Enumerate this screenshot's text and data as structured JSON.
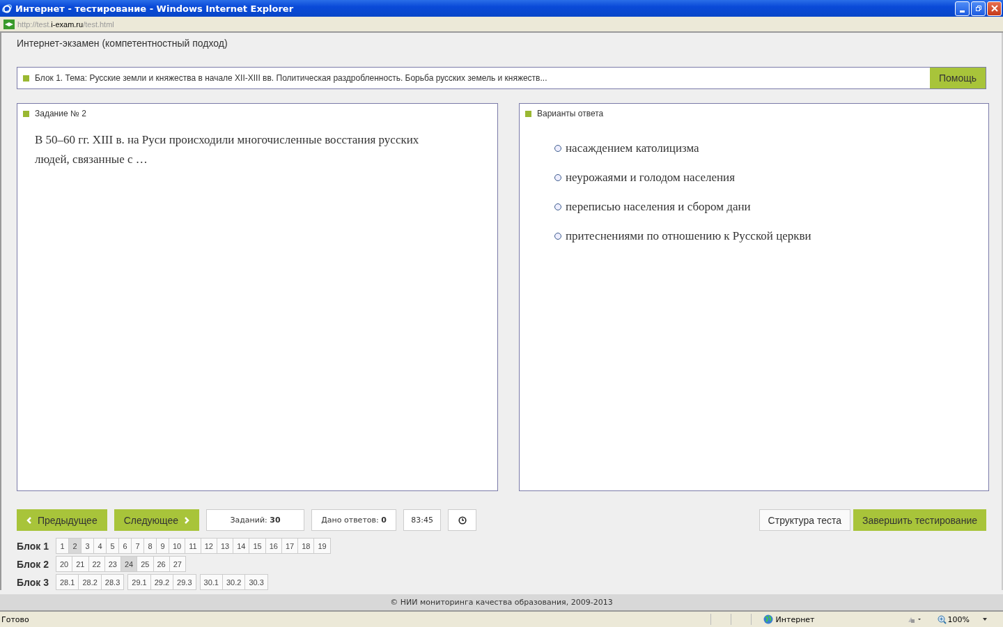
{
  "window": {
    "title": "Интернет - тестирование - Windows Internet Explorer"
  },
  "address": {
    "prefix": "http://test.",
    "domain": "i-exam.ru",
    "path": "/test.html"
  },
  "page_title": "Интернет-экзамен (компетентностный подход)",
  "topic": {
    "text": "Блок 1. Тема: Русские земли и княжества в начале XII-XIII вв. Политическая раздробленность. Борьба русских земель и княжеств...",
    "help_button": "Помощь"
  },
  "task": {
    "heading": "Задание № 2",
    "question": "В 50–60 гг. XIII в. на Руси происходили многочисленные восстания русских людей, связанные с …"
  },
  "answers": {
    "heading": "Варианты ответа",
    "options": [
      {
        "label": "насаждением католицизма",
        "selected": false
      },
      {
        "label": "неурожаями и голодом населения",
        "selected": false
      },
      {
        "label": "переписью населения и сбором дани",
        "selected": false
      },
      {
        "label": "притеснениями по отношению к Русской церкви",
        "selected": false
      }
    ]
  },
  "nav": {
    "prev": "Предыдущее",
    "next": "Следующее",
    "tasks_label": "Заданий:",
    "tasks_count": "30",
    "answered_label": "Дано ответов:",
    "answered_count": "0",
    "timer": "83:45",
    "structure": "Структура теста",
    "finish": "Завершить тестирование"
  },
  "blocks": [
    {
      "label": "Блок 1",
      "groups": [
        [
          {
            "n": "1",
            "selected": false
          },
          {
            "n": "2",
            "selected": true
          },
          {
            "n": "3",
            "selected": false
          },
          {
            "n": "4",
            "selected": false
          },
          {
            "n": "5",
            "selected": false
          },
          {
            "n": "6",
            "selected": false
          },
          {
            "n": "7",
            "selected": false
          },
          {
            "n": "8",
            "selected": false
          },
          {
            "n": "9",
            "selected": false
          },
          {
            "n": "10",
            "selected": false
          },
          {
            "n": "11",
            "selected": false
          },
          {
            "n": "12",
            "selected": false
          },
          {
            "n": "13",
            "selected": false
          },
          {
            "n": "14",
            "selected": false
          },
          {
            "n": "15",
            "selected": false
          },
          {
            "n": "16",
            "selected": false
          },
          {
            "n": "17",
            "selected": false
          },
          {
            "n": "18",
            "selected": false
          },
          {
            "n": "19",
            "selected": false
          }
        ]
      ]
    },
    {
      "label": "Блок 2",
      "groups": [
        [
          {
            "n": "20",
            "selected": false
          },
          {
            "n": "21",
            "selected": false
          },
          {
            "n": "22",
            "selected": false
          },
          {
            "n": "23",
            "selected": false
          },
          {
            "n": "24",
            "selected": true
          },
          {
            "n": "25",
            "selected": false
          },
          {
            "n": "26",
            "selected": false
          },
          {
            "n": "27",
            "selected": false
          }
        ]
      ]
    },
    {
      "label": "Блок 3",
      "groups": [
        [
          {
            "n": "28.1",
            "selected": false
          },
          {
            "n": "28.2",
            "selected": false
          },
          {
            "n": "28.3",
            "selected": false
          }
        ],
        [
          {
            "n": "29.1",
            "selected": false
          },
          {
            "n": "29.2",
            "selected": false
          },
          {
            "n": "29.3",
            "selected": false
          }
        ],
        [
          {
            "n": "30.1",
            "selected": false
          },
          {
            "n": "30.2",
            "selected": false
          },
          {
            "n": "30.3",
            "selected": false
          }
        ]
      ]
    }
  ],
  "footer": "© НИИ мониторинга качества образования, 2009-2013",
  "status_bar": {
    "status": "Готово",
    "zone": "Интернет",
    "zoom": "100%"
  }
}
